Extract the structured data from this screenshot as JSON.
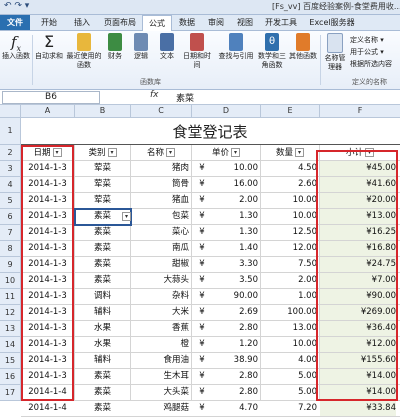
{
  "window": {
    "title": "[Fs_vv] 百度经验案例-食堂费用收...",
    "quick_access": "↶ ↷ ▾"
  },
  "tabs": [
    {
      "label": "文件",
      "active": false
    },
    {
      "label": "开始",
      "active": false
    },
    {
      "label": "插入",
      "active": false
    },
    {
      "label": "页面布局",
      "active": false
    },
    {
      "label": "公式",
      "active": true
    },
    {
      "label": "数据",
      "active": false
    },
    {
      "label": "审阅",
      "active": false
    },
    {
      "label": "视图",
      "active": false
    },
    {
      "label": "开发工具",
      "active": false
    },
    {
      "label": "Excel服务器",
      "active": false
    }
  ],
  "ribbon": {
    "buttons": [
      {
        "label": "插入函数",
        "icon": "fx-icon",
        "color": "#ffffff"
      },
      {
        "label": "自动求和",
        "icon": "sigma-icon",
        "color": "#ffffff"
      },
      {
        "label": "最近使用的函数",
        "icon": "star-book-icon",
        "color": "#e8b73c"
      },
      {
        "label": "财务",
        "icon": "finance-book-icon",
        "color": "#3d8c43"
      },
      {
        "label": "逻辑",
        "icon": "logic-book-icon",
        "color": "#6e8bb3"
      },
      {
        "label": "文本",
        "icon": "text-book-icon",
        "color": "#4a6fa5"
      },
      {
        "label": "日期和时间",
        "icon": "date-book-icon",
        "color": "#c0504d"
      },
      {
        "label": "查找与引用",
        "icon": "lookup-book-icon",
        "color": "#4f81bd"
      },
      {
        "label": "数学和三角函数",
        "icon": "theta-book-icon",
        "color": "#2f6fad"
      },
      {
        "label": "其他函数",
        "icon": "more-book-icon",
        "color": "#e07b2a"
      }
    ],
    "group_label": "函数库",
    "side_items": [
      "定义名称 ▾",
      "用于公式 ▾",
      "根据所选内容"
    ],
    "side_manager": "名称管理器",
    "side_group_label": "定义的名称"
  },
  "formula_bar": {
    "name_box": "B6",
    "fx": "fx",
    "value": "素菜"
  },
  "columns": [
    "A",
    "B",
    "C",
    "D",
    "E",
    "F"
  ],
  "rows": [
    "1",
    "2",
    "3",
    "4",
    "5",
    "6",
    "7",
    "8",
    "9",
    "10",
    "11",
    "12",
    "13",
    "14",
    "15",
    "16",
    "17",
    "18"
  ],
  "sheet": {
    "title": "食堂登记表",
    "headers": [
      "日期",
      "类别",
      "名称",
      "单价",
      "数量",
      "小计"
    ],
    "data": [
      [
        "2014-1-3",
        "荤菜",
        "猪肉",
        "¥",
        "10.00",
        "4.50",
        "¥45.00"
      ],
      [
        "2014-1-3",
        "荤菜",
        "筒骨",
        "¥",
        "16.00",
        "2.60",
        "¥41.60"
      ],
      [
        "2014-1-3",
        "荤菜",
        "猪血",
        "¥",
        "2.00",
        "10.00",
        "¥20.00"
      ],
      [
        "2014-1-3",
        "素菜",
        "包菜",
        "¥",
        "1.30",
        "10.00",
        "¥13.00"
      ],
      [
        "2014-1-3",
        "素菜",
        "菜心",
        "¥",
        "1.30",
        "12.50",
        "¥16.25"
      ],
      [
        "2014-1-3",
        "素菜",
        "南瓜",
        "¥",
        "1.40",
        "12.00",
        "¥16.80"
      ],
      [
        "2014-1-3",
        "素菜",
        "甜椒",
        "¥",
        "3.30",
        "7.50",
        "¥24.75"
      ],
      [
        "2014-1-3",
        "素菜",
        "大蒜头",
        "¥",
        "3.50",
        "2.00",
        "¥7.00"
      ],
      [
        "2014-1-3",
        "调料",
        "杂料",
        "¥",
        "90.00",
        "1.00",
        "¥90.00"
      ],
      [
        "2014-1-3",
        "辅料",
        "大米",
        "¥",
        "2.69",
        "100.00",
        "¥269.00"
      ],
      [
        "2014-1-3",
        "水果",
        "香蕉",
        "¥",
        "2.80",
        "13.00",
        "¥36.40"
      ],
      [
        "2014-1-3",
        "水果",
        "橙",
        "¥",
        "1.20",
        "10.00",
        "¥12.00"
      ],
      [
        "2014-1-3",
        "辅料",
        "食用油",
        "¥",
        "38.90",
        "4.00",
        "¥155.60"
      ],
      [
        "2014-1-3",
        "素菜",
        "生木耳",
        "¥",
        "2.80",
        "5.00",
        "¥14.00"
      ],
      [
        "2014-1-4",
        "素菜",
        "大头菜",
        "¥",
        "2.80",
        "5.00",
        "¥14.00"
      ],
      [
        "2014-1-4",
        "素菜",
        "鸡腿菇",
        "¥",
        "4.70",
        "7.20",
        "¥33.84"
      ]
    ]
  },
  "colors": {
    "file_tab": "#2a6fb0",
    "highlight_box": "#d6262b",
    "selection": "#2b5797"
  }
}
